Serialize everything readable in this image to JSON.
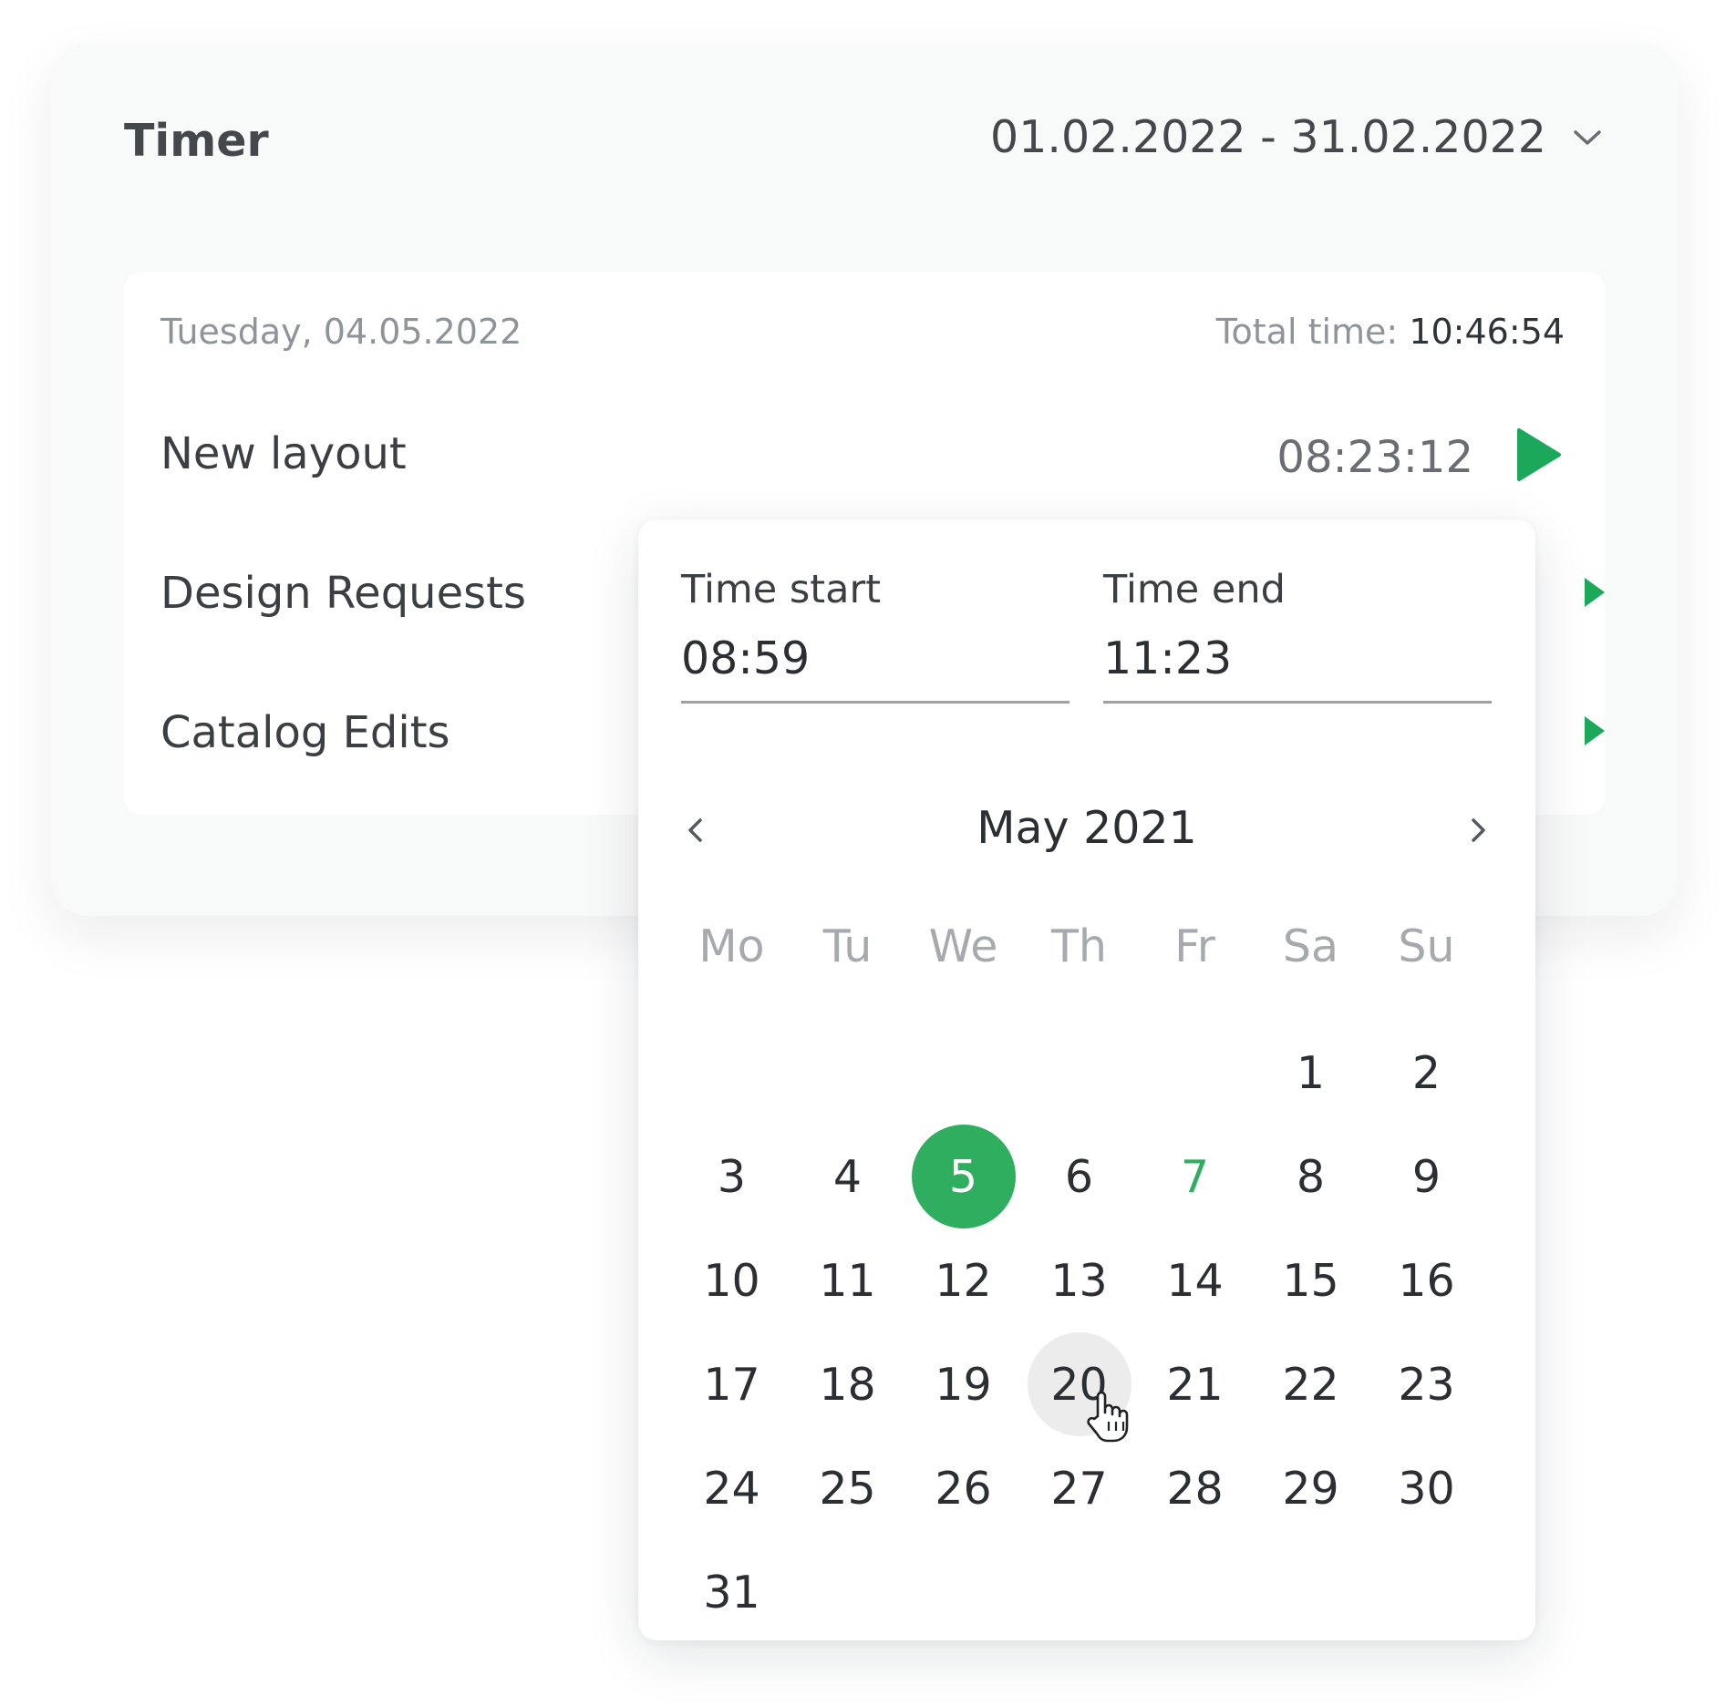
{
  "timer": {
    "title": "Timer",
    "date_range": "01.02.2022 - 31.02.2022"
  },
  "day": {
    "date": "Tuesday, 04.05.2022",
    "total_label": "Total time:",
    "total_value": "10:46:54"
  },
  "entries": [
    {
      "name": "New layout",
      "duration": "08:23:12"
    },
    {
      "name": "Design Requests",
      "duration": ""
    },
    {
      "name": "Catalog Edits",
      "duration": ""
    }
  ],
  "picker": {
    "time_start_label": "Time start",
    "time_start_value": "08:59",
    "time_end_label": "Time end",
    "time_end_value": "11:23",
    "month_title": "May 2021",
    "weekdays": [
      "Mo",
      "Tu",
      "We",
      "Th",
      "Fr",
      "Sa",
      "Su"
    ],
    "days": [
      "",
      "",
      "",
      "",
      "",
      "1",
      "2",
      "3",
      "4",
      "5",
      "6",
      "7",
      "8",
      "9",
      "10",
      "11",
      "12",
      "13",
      "14",
      "15",
      "16",
      "17",
      "18",
      "19",
      "20",
      "21",
      "22",
      "23",
      "24",
      "25",
      "26",
      "27",
      "28",
      "29",
      "30",
      "31"
    ],
    "selected_day": "5",
    "today_day": "7",
    "hover_day": "20"
  },
  "colors": {
    "accent": "#2fae60",
    "play": "#1ca85a"
  },
  "icons": {
    "range_toggle": "chevron-down-icon",
    "entry_action": "play-icon",
    "prev_month": "chevron-left-icon",
    "next_month": "chevron-right-icon",
    "pointer": "hand-cursor-icon"
  }
}
